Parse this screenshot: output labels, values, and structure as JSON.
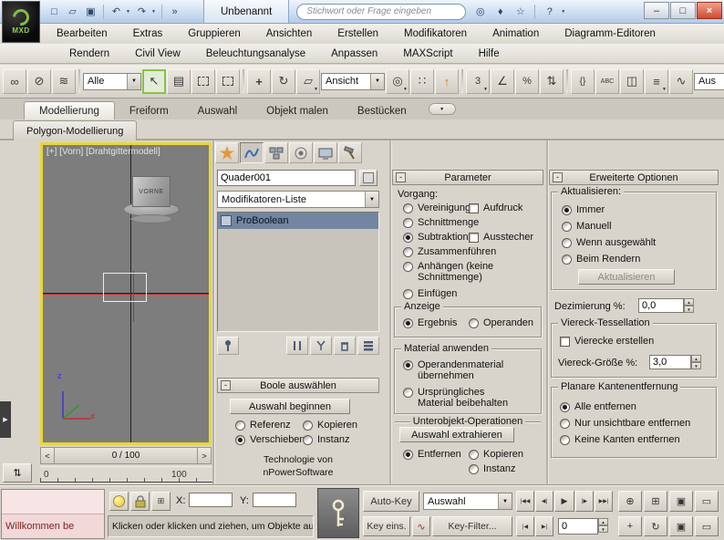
{
  "titlebar": {
    "logo": "MXD",
    "doc_tab": "Unbenannt",
    "search_placeholder": "Stichwort oder Frage eingeben"
  },
  "menus": {
    "row1": [
      "Bearbeiten",
      "Extras",
      "Gruppieren",
      "Ansichten",
      "Erstellen",
      "Modifikatoren",
      "Animation",
      "Diagramm-Editoren"
    ],
    "row2": [
      "Rendern",
      "Civil View",
      "Beleuchtungsanalyse",
      "Anpassen",
      "MAXScript",
      "Hilfe"
    ]
  },
  "toolbar": {
    "filter": "Alle",
    "coord": "Ansicht",
    "named": "Aus"
  },
  "ribbon": {
    "tabs": [
      "Modellierung",
      "Freiform",
      "Auswahl",
      "Objekt malen",
      "Bestücken"
    ],
    "subtab": "Polygon-Modellierung"
  },
  "viewport": {
    "label": "[+] [Vorn] [Drahtgittermodell]",
    "object_label": "VORNE",
    "axis_x": "x",
    "axis_z": "z",
    "time": "0 / 100",
    "r0": "0",
    "r100": "100"
  },
  "panel": {
    "object_name": "Quader001",
    "modifier_list": "Modifikatoren-Liste",
    "modifier": "ProBoolean",
    "boole_title": "Boole auswählen",
    "begin_button": "Auswahl beginnen",
    "referenz": "Referenz",
    "kopieren": "Kopieren",
    "verschieben": "Verschieben",
    "instanz": "Instanz",
    "tech1": "Technologie von",
    "tech2": "nPowerSoftware"
  },
  "parameters": {
    "title": "Parameter",
    "vorgang": "Vorgang:",
    "vereinigung": "Vereinigung",
    "schnittmenge": "Schnittmenge",
    "subtraktion": "Subtraktion",
    "zusammen": "Zusammenführen",
    "anhaengen": "Anhängen (keine Schnittmenge)",
    "einfuegen": "Einfügen",
    "aufdruck": "Aufdruck",
    "ausstecher": "Ausstecher",
    "anzeige": "Anzeige",
    "ergebnis": "Ergebnis",
    "operanden": "Operanden",
    "material": "Material anwenden",
    "mat_op": "Operandenmaterial übernehmen",
    "mat_ur": "Ursprüngliches Material beibehalten",
    "subobj": "Unterobjekt-Operationen",
    "extract": "Auswahl extrahieren",
    "entfernen": "Entfernen",
    "kopieren": "Kopieren",
    "instanz": "Instanz"
  },
  "advanced": {
    "title": "Erweiterte Optionen",
    "update": "Aktualisieren:",
    "immer": "Immer",
    "manuell": "Manuell",
    "wenn": "Wenn ausgewählt",
    "beim": "Beim Rendern",
    "update_btn": "Aktualisieren",
    "dez_label": "Dezimierung %:",
    "dez_value": "0,0",
    "quad_title": "Viereck-Tessellation",
    "quad_cb": "Vierecke erstellen",
    "quad_size": "Viereck-Größe %:",
    "quad_val": "3,0",
    "planar_title": "Planare Kantenentfernung",
    "alle": "Alle entfernen",
    "nur": "Nur unsichtbare entfernen",
    "keine": "Keine Kanten entfernen"
  },
  "statusbar": {
    "welcome": "Willkommen be",
    "x": "X:",
    "y": "Y:",
    "prompt": "Klicken oder klicken und ziehen, um Objekte aus",
    "autokey": "Auto-Key",
    "keyeins": "Key eins.",
    "keyfilter": "Key-Filter...",
    "selection": "Auswahl",
    "frame": "0"
  },
  "icons": {
    "new": "□",
    "open": "▱",
    "save": "▣",
    "undo": "↶",
    "redo": "↷",
    "overflow": "»",
    "search_db": "◎",
    "comm": "♦",
    "star": "☆",
    "help": "?",
    "dropdown": "▼",
    "minus": "-",
    "min": "–",
    "max": "□",
    "close": "×",
    "link": "∞",
    "unlink": "⊘",
    "bindsw": "≋",
    "select": "↖",
    "by_name": "▤",
    "move": "+",
    "rotate": "↻",
    "scale": "▱",
    "pivot": "◎",
    "manipulate": "∷",
    "kbd": "#",
    "snap3": "3",
    "snap_angle": "∠",
    "snap_percent": "%",
    "snap_spinner": "⇅",
    "sets": "{}",
    "rename": "ABC",
    "mirror": "◫",
    "align": "≡",
    "curves": "∿",
    "uparrow": "↑",
    "spin_up": "▲",
    "spin_down": "▼",
    "go_start": "|◀◀",
    "prev_frame": "◀|",
    "play": "▶",
    "next_frame": "|▶",
    "go_end": "▶▶|",
    "key_prev": "|◀",
    "key_next": "▶|",
    "zoom": "⊕",
    "zoom_all": "⊞",
    "zoom_ext": "▣",
    "zoom_region": "▭",
    "pan": "+",
    "orbit": "↻",
    "maximize": "▣",
    "grid": "⊞",
    "wave": "∿",
    "updown": "⇅",
    "step_left": "<",
    "step_right": ">",
    "side_play": "▶"
  }
}
